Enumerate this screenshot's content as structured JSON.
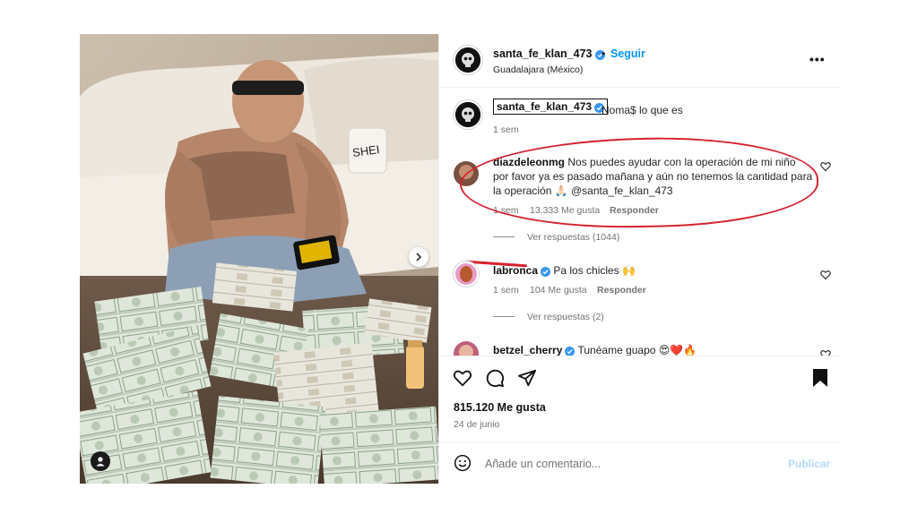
{
  "post": {
    "author": "santa_fe_klan_473",
    "follow_label": "Seguir",
    "dot": "•",
    "location": "Guadalajara (México)",
    "more_label": "•••",
    "caption": {
      "username": "santa_fe_klan_473",
      "text": "Noma$ lo que es",
      "time": "1 sem"
    },
    "comments": [
      {
        "username": "diazdeleonmg",
        "text": "Nos puedes ayudar con la operación de mi niño por favor ya es pasado mañana y aún no tenemos la cantidad para la operación 🙏🏻 @santa_fe_klan_473",
        "time": "1 sem",
        "likes": "13.333 Me gusta",
        "reply_label": "Responder",
        "view_replies": "Ver respuestas (1044)"
      },
      {
        "username": "labronca",
        "text": "Pa los chicles 🙌",
        "time": "1 sem",
        "likes": "104 Me gusta",
        "reply_label": "Responder",
        "view_replies": "Ver respuestas (2)"
      },
      {
        "username": "betzel_cherry",
        "text": "Tunéame guapo 😍❤️🔥"
      }
    ],
    "likes_count": "815.120 Me gusta",
    "date": "24 de junio",
    "comment_placeholder": "Añade un comentario...",
    "publish_label": "Publicar"
  },
  "icons": {
    "like": "heart-icon",
    "comment": "comment-icon",
    "share": "share-icon",
    "save": "bookmark-icon",
    "emoji": "emoji-icon",
    "next": "chevron-right-icon",
    "tagged": "user-icon"
  },
  "colors": {
    "link_blue": "#0095f6",
    "verified_blue": "#3897f0",
    "annotation_red": "#d4232f",
    "muted_text": "#737373"
  }
}
